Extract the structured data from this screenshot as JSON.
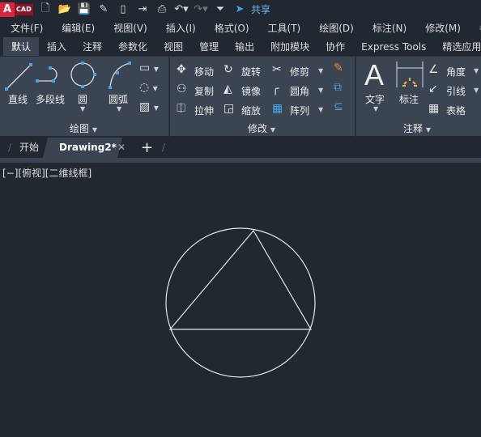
{
  "app": {
    "logo": "A",
    "logo_sub": "CAD",
    "share": "共享"
  },
  "quick_access": [
    "new-icon",
    "open-icon",
    "save-icon",
    "save-as-icon",
    "open-device-icon",
    "save-device-icon",
    "print-icon",
    "undo-icon",
    "redo-icon",
    "customize-icon"
  ],
  "menu": [
    "文件(F)",
    "编辑(E)",
    "视图(V)",
    "插入(I)",
    "格式(O)",
    "工具(T)",
    "绘图(D)",
    "标注(N)",
    "修改(M)",
    "参"
  ],
  "ribbon_tabs": [
    "默认",
    "插入",
    "注释",
    "参数化",
    "视图",
    "管理",
    "输出",
    "附加模块",
    "协作",
    "Express Tools",
    "精选应用"
  ],
  "active_ribbon_tab": "默认",
  "draw_panel": {
    "title": "绘图",
    "tools": [
      "直线",
      "多段线",
      "圆",
      "圆弧"
    ]
  },
  "modify_panel": {
    "title": "修改",
    "tools": [
      "移动",
      "旋转",
      "修剪",
      "复制",
      "镜像",
      "圆角",
      "拉伸",
      "缩放",
      "阵列"
    ]
  },
  "annotate_panel": {
    "title": "注释",
    "tools": [
      "文字",
      "标注",
      "角度",
      "引线",
      "表格"
    ]
  },
  "file_tabs": [
    "开始",
    "Drawing2*"
  ],
  "active_file_tab": "Drawing2*",
  "viewport_label": "[−][俯视][二维线框]",
  "colors": {
    "accent": "#4aa3e8",
    "background": "#212830",
    "ribbon": "#3b4453",
    "logo": "#d9263e"
  }
}
